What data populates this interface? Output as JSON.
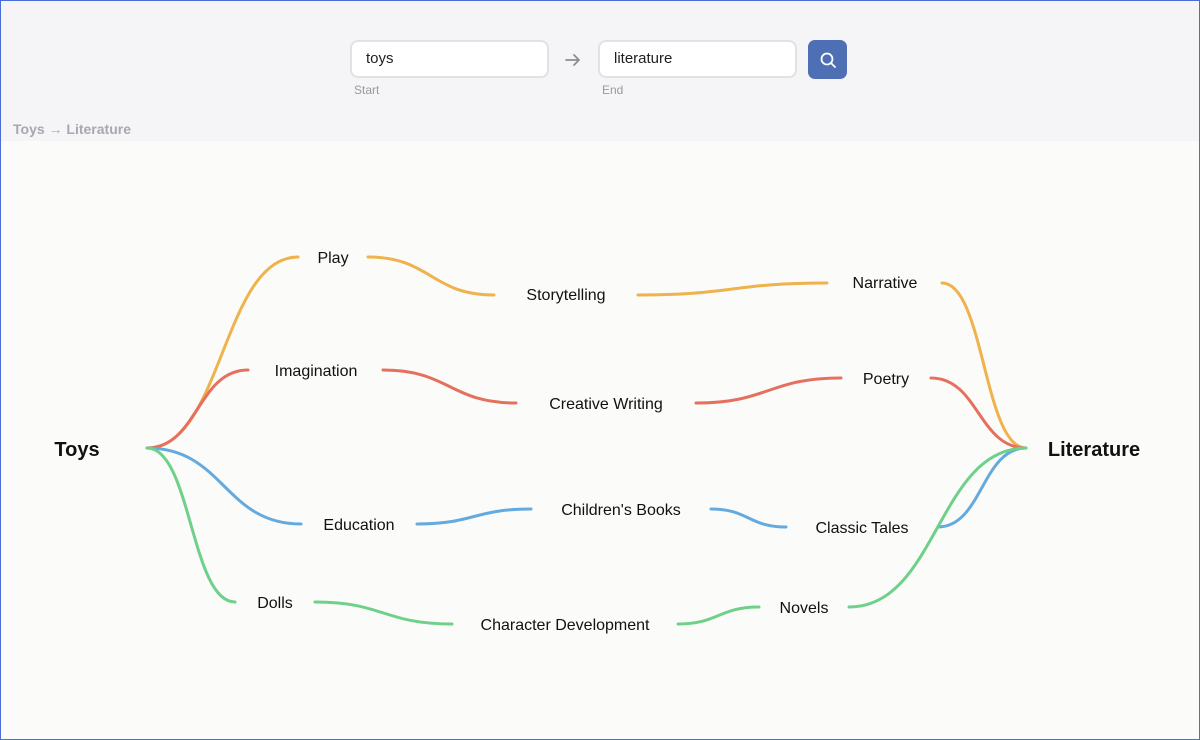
{
  "search": {
    "start_value": "toys",
    "end_value": "literature",
    "start_caption": "Start",
    "end_caption": "End"
  },
  "breadcrumb": "Toys → Literature",
  "graph": {
    "nodes": {
      "toys": "Toys",
      "literature": "Literature",
      "play": "Play",
      "storytelling": "Storytelling",
      "narrative": "Narrative",
      "imagination": "Imagination",
      "creative_writing": "Creative Writing",
      "poetry": "Poetry",
      "education": "Education",
      "childrens_books": "Children's Books",
      "classic_tales": "Classic Tales",
      "dolls": "Dolls",
      "character_development": "Character Development",
      "novels": "Novels"
    },
    "paths": [
      {
        "color": "#efb24c",
        "nodes": [
          "toys",
          "play",
          "storytelling",
          "narrative",
          "literature"
        ]
      },
      {
        "color": "#e5705e",
        "nodes": [
          "toys",
          "imagination",
          "creative_writing",
          "poetry",
          "literature"
        ]
      },
      {
        "color": "#64aadf",
        "nodes": [
          "toys",
          "education",
          "childrens_books",
          "classic_tales",
          "literature"
        ]
      },
      {
        "color": "#6fd08a",
        "nodes": [
          "toys",
          "dolls",
          "character_development",
          "novels",
          "literature"
        ]
      }
    ]
  },
  "icons": {
    "arrow": "right-arrow-icon",
    "search": "search-icon"
  }
}
